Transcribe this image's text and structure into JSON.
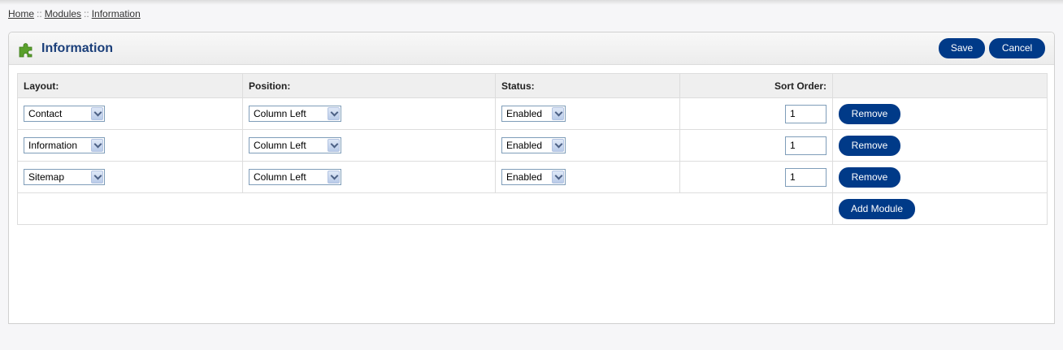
{
  "breadcrumb": {
    "items": [
      "Home",
      "Modules",
      "Information"
    ],
    "separator": "::"
  },
  "heading": {
    "icon": "puzzle-piece-icon",
    "title": "Information",
    "save_label": "Save",
    "cancel_label": "Cancel"
  },
  "table": {
    "headers": {
      "layout": "Layout:",
      "position": "Position:",
      "status": "Status:",
      "sort_order": "Sort Order:"
    },
    "rows": [
      {
        "layout": "Contact",
        "position": "Column Left",
        "status": "Enabled",
        "sort_order": "1",
        "remove_label": "Remove"
      },
      {
        "layout": "Information",
        "position": "Column Left",
        "status": "Enabled",
        "sort_order": "1",
        "remove_label": "Remove"
      },
      {
        "layout": "Sitemap",
        "position": "Column Left",
        "status": "Enabled",
        "sort_order": "1",
        "remove_label": "Remove"
      }
    ],
    "add_module_label": "Add Module"
  },
  "colors": {
    "button": "#003a88",
    "title": "#1b3f7a",
    "icon": "#5aa02c"
  }
}
